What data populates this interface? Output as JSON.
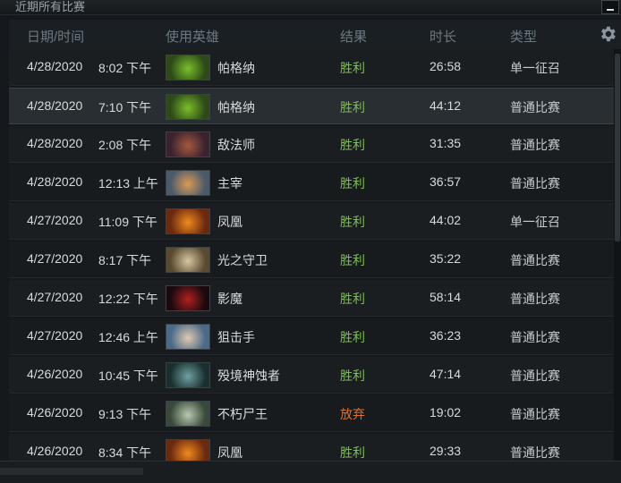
{
  "panel": {
    "title": "近期所有比赛"
  },
  "headers": {
    "date_time": "日期/时间",
    "hero": "使用英雄",
    "result": "结果",
    "duration": "时长",
    "type": "类型"
  },
  "matches": [
    {
      "date": "4/28/2020",
      "time": "8:02 下午",
      "hero": "帕格纳",
      "result": "胜利",
      "duration": "26:58",
      "type": "单一征召"
    },
    {
      "date": "4/28/2020",
      "time": "7:10 下午",
      "hero": "帕格纳",
      "result": "胜利",
      "duration": "44:12",
      "type": "普通比赛"
    },
    {
      "date": "4/28/2020",
      "time": "2:08 下午",
      "hero": "敌法师",
      "result": "胜利",
      "duration": "31:35",
      "type": "普通比赛"
    },
    {
      "date": "4/28/2020",
      "time": "12:13 上午",
      "hero": "主宰",
      "result": "胜利",
      "duration": "36:57",
      "type": "普通比赛"
    },
    {
      "date": "4/27/2020",
      "time": "11:09 下午",
      "hero": "凤凰",
      "result": "胜利",
      "duration": "44:02",
      "type": "单一征召"
    },
    {
      "date": "4/27/2020",
      "time": "8:17 下午",
      "hero": "光之守卫",
      "result": "胜利",
      "duration": "35:22",
      "type": "普通比赛"
    },
    {
      "date": "4/27/2020",
      "time": "12:22 下午",
      "hero": "影魔",
      "result": "胜利",
      "duration": "58:14",
      "type": "普通比赛"
    },
    {
      "date": "4/27/2020",
      "time": "12:46 上午",
      "hero": "狙击手",
      "result": "胜利",
      "duration": "36:23",
      "type": "普通比赛"
    },
    {
      "date": "4/26/2020",
      "time": "10:45 下午",
      "hero": "殁境神蚀者",
      "result": "胜利",
      "duration": "47:14",
      "type": "普通比赛"
    },
    {
      "date": "4/26/2020",
      "time": "9:13 下午",
      "hero": "不朽尸王",
      "result": "放弃",
      "duration": "19:02",
      "type": "普通比赛"
    },
    {
      "date": "4/26/2020",
      "time": "8:34 下午",
      "hero": "凤凰",
      "result": "胜利",
      "duration": "29:33",
      "type": "普通比赛"
    }
  ],
  "hero_colors": {
    "帕格纳": [
      "#2d4a18",
      "#7bbf2a"
    ],
    "敌法师": [
      "#3a2230",
      "#a5593c"
    ],
    "主宰": [
      "#4a5a6a",
      "#d99a56"
    ],
    "凤凰": [
      "#6b2a10",
      "#f08a1e"
    ],
    "光之守卫": [
      "#5a4a30",
      "#d8c7a0"
    ],
    "影魔": [
      "#1a0a0e",
      "#b32020"
    ],
    "狙击手": [
      "#4a6a88",
      "#e0c9b0"
    ],
    "殁境神蚀者": [
      "#1a3030",
      "#6fa0a0"
    ],
    "不朽尸王": [
      "#3a4a3a",
      "#b8c8b0"
    ]
  },
  "colors": {
    "win": "#7fbd5a",
    "abandon": "#e0702a"
  },
  "icons": {
    "settings": "gear-icon",
    "collapse": "minimize-icon"
  }
}
